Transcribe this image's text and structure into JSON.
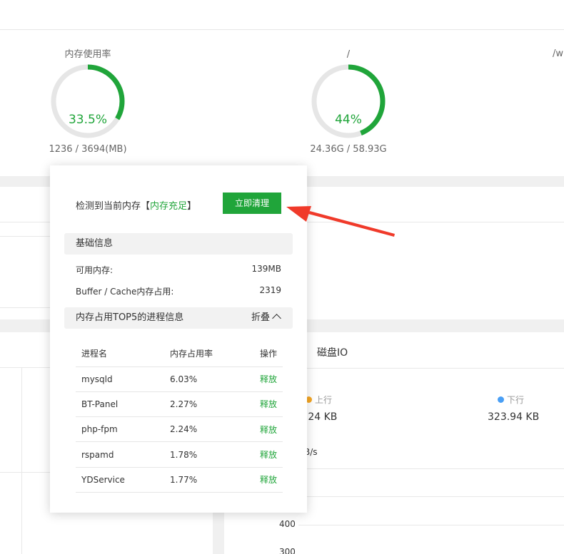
{
  "gauges": [
    {
      "label": "内存使用率",
      "percent": 33.5,
      "value_text": "33.5%",
      "sub": "1236 / 3694(MB)"
    },
    {
      "label": "/",
      "percent": 44,
      "value_text": "44%",
      "sub": "24.36G / 58.93G"
    }
  ],
  "gauge_truncated_label": "/w",
  "colors": {
    "accent": "#20a53a",
    "track": "#e6e6e6",
    "arrow": "#f03a2a",
    "upload_dot": "#f5a623",
    "download_dot": "#4a9ff5"
  },
  "disk_io": {
    "title": "磁盘IO",
    "upload_label": "上行",
    "download_label": "下行",
    "upload_value": "5.24 KB",
    "download_value": "323.94 KB",
    "unit_label": "B/s",
    "ticks": [
      "400",
      "300"
    ]
  },
  "popup": {
    "status_prefix": "检测到当前内存【",
    "status_value": "内存充足",
    "status_suffix": "】",
    "clean_button": "立即清理",
    "basic_title": "基础信息",
    "available_label": "可用内存:",
    "available_value": "139MB",
    "buffer_label": "Buffer / Cache内存占用:",
    "buffer_value": "2319",
    "top5_title": "内存占用TOP5的进程信息",
    "fold_label": "折叠",
    "columns": [
      "进程名",
      "内存占用率",
      "操作"
    ],
    "rows": [
      {
        "name": "mysqld",
        "usage": "6.03%",
        "action": "释放"
      },
      {
        "name": "BT-Panel",
        "usage": "2.27%",
        "action": "释放"
      },
      {
        "name": "php-fpm",
        "usage": "2.24%",
        "action": "释放"
      },
      {
        "name": "rspamd",
        "usage": "1.78%",
        "action": "释放"
      },
      {
        "name": "YDService",
        "usage": "1.77%",
        "action": "释放"
      }
    ]
  }
}
